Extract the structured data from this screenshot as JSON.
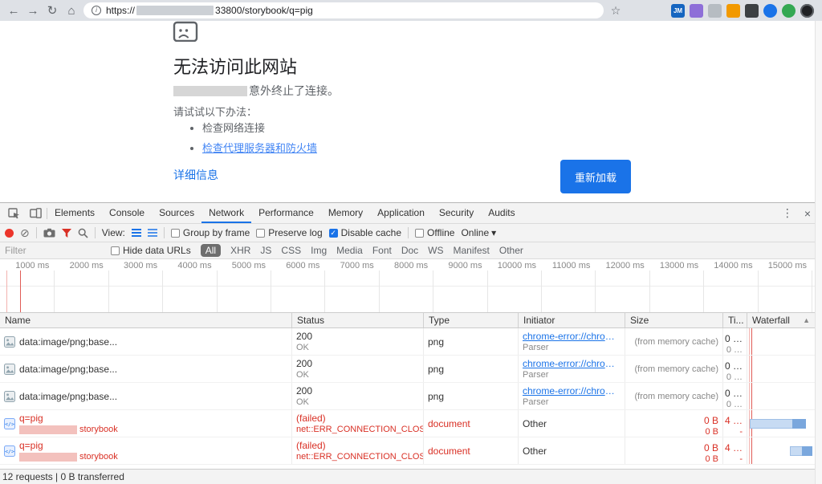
{
  "colors": {
    "accent_blue": "#1a73e8",
    "link_blue": "#4285f4",
    "error_red": "#d93025"
  },
  "icons": {
    "back": "←",
    "forward": "→",
    "reload": "↻",
    "home": "⌂",
    "info": "i",
    "star": "☆",
    "more": "⋮",
    "close": "×",
    "clear": "⊘",
    "dropdown": "▾",
    "sort_up": "▲",
    "check": "✓"
  },
  "browser": {
    "url_scheme": "https://",
    "url_tail": "33800/storybook/q=pig",
    "extension_badge": "JM"
  },
  "error_page": {
    "title": "无法访问此网站",
    "message_suffix": "意外终止了连接。",
    "try_header": "请试试以下办法：",
    "suggestions": [
      "检查网络连接",
      "检查代理服务器和防火墙"
    ],
    "details_label": "详细信息",
    "reload_label": "重新加载"
  },
  "devtools": {
    "tabs": [
      "Elements",
      "Console",
      "Sources",
      "Network",
      "Performance",
      "Memory",
      "Application",
      "Security",
      "Audits"
    ],
    "active_tab": "Network",
    "toolbar": {
      "view_label": "View:",
      "group_by_frame": "Group by frame",
      "preserve_log": "Preserve log",
      "disable_cache": "Disable cache",
      "offline": "Offline",
      "throttling": "Online"
    },
    "filter_bar": {
      "placeholder": "Filter",
      "hide_data_urls": "Hide data URLs",
      "pills": [
        "All",
        "XHR",
        "JS",
        "CSS",
        "Img",
        "Media",
        "Font",
        "Doc",
        "WS",
        "Manifest",
        "Other"
      ],
      "active_pill": "All"
    },
    "timeline_ticks": [
      "1000 ms",
      "2000 ms",
      "3000 ms",
      "4000 ms",
      "5000 ms",
      "6000 ms",
      "7000 ms",
      "8000 ms",
      "9000 ms",
      "10000 ms",
      "11000 ms",
      "12000 ms",
      "13000 ms",
      "14000 ms",
      "15000 ms"
    ],
    "table": {
      "headers": {
        "name": "Name",
        "status": "Status",
        "type": "Type",
        "initiator": "Initiator",
        "size": "Size",
        "time": "Ti...",
        "waterfall": "Waterfall"
      },
      "rows": [
        {
          "name": "data:image/png;base...",
          "status": "200",
          "status_sub": "OK",
          "type": "png",
          "initiator": "chrome-error://chromewe...",
          "initiator_sub": "Parser",
          "size": "(from memory cache)",
          "time": "0 …",
          "time_sub": "0 …"
        },
        {
          "name": "data:image/png;base...",
          "status": "200",
          "status_sub": "OK",
          "type": "png",
          "initiator": "chrome-error://chromewe...",
          "initiator_sub": "Parser",
          "size": "(from memory cache)",
          "time": "0 …",
          "time_sub": "0 …"
        },
        {
          "name": "data:image/png;base...",
          "status": "200",
          "status_sub": "OK",
          "type": "png",
          "initiator": "chrome-error://chromewe...",
          "initiator_sub": "Parser",
          "size": "(from memory cache)",
          "time": "0 …",
          "time_sub": "0 …"
        },
        {
          "name": "q=pig",
          "name_sub": "storybook",
          "status": "(failed)",
          "status_sub": "net::ERR_CONNECTION_CLOSED",
          "type": "document",
          "initiator": "Other",
          "size": "0 B",
          "size_sub": "0 B",
          "time": "4 …",
          "time_sub": "-"
        },
        {
          "name": "q=pig",
          "name_sub": "storybook",
          "status": "(failed)",
          "status_sub": "net::ERR_CONNECTION_CLOSED",
          "type": "document",
          "initiator": "Other",
          "size": "0 B",
          "size_sub": "0 B",
          "time": "4 …",
          "time_sub": "-"
        }
      ]
    },
    "status_bar": "12 requests  |  0 B transferred"
  }
}
